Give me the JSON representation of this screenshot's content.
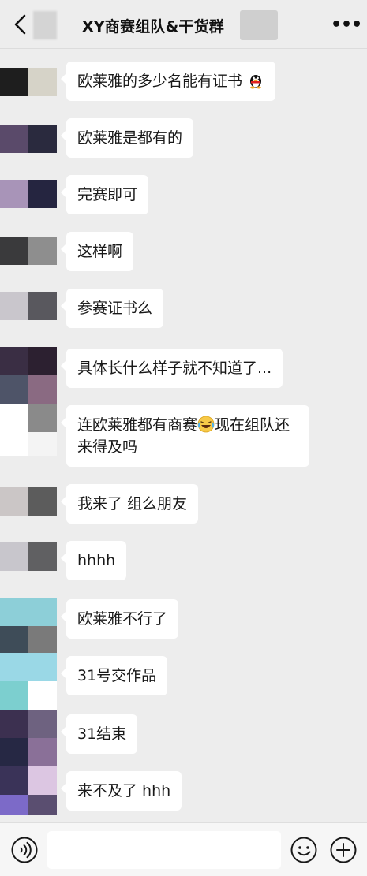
{
  "header": {
    "title": "XY商赛组队&干货群",
    "back_icon": "chevron-left-icon",
    "more_icon": "more-dots-icon",
    "more_label": "•••"
  },
  "messages": [
    {
      "text": "欧莱雅的多少名能有证书",
      "emoji": "qq-penguin-icon"
    },
    {
      "text": "欧莱雅是都有的"
    },
    {
      "text": "完赛即可"
    },
    {
      "text": "这样啊"
    },
    {
      "text": "参赛证书么"
    },
    {
      "text": "具体长什么样子就不知道了..."
    },
    {
      "text_a": "连欧莱雅都有商赛",
      "emoji": "laughing-tears-icon",
      "text_b": "现在组队还来得及吗"
    },
    {
      "text": "我来了 组么朋友"
    },
    {
      "text": "hhhh"
    },
    {
      "text": "欧莱雅不行了"
    },
    {
      "text": "31号交作品"
    },
    {
      "text": "31结束"
    },
    {
      "text": "来不及了 hhh"
    }
  ],
  "input_bar": {
    "voice_icon": "voice-icon",
    "emoji_icon": "emoji-icon",
    "plus_icon": "plus-icon",
    "placeholder": ""
  },
  "colors": {
    "background": "#ededed",
    "bubble": "#ffffff",
    "text": "#191919"
  }
}
